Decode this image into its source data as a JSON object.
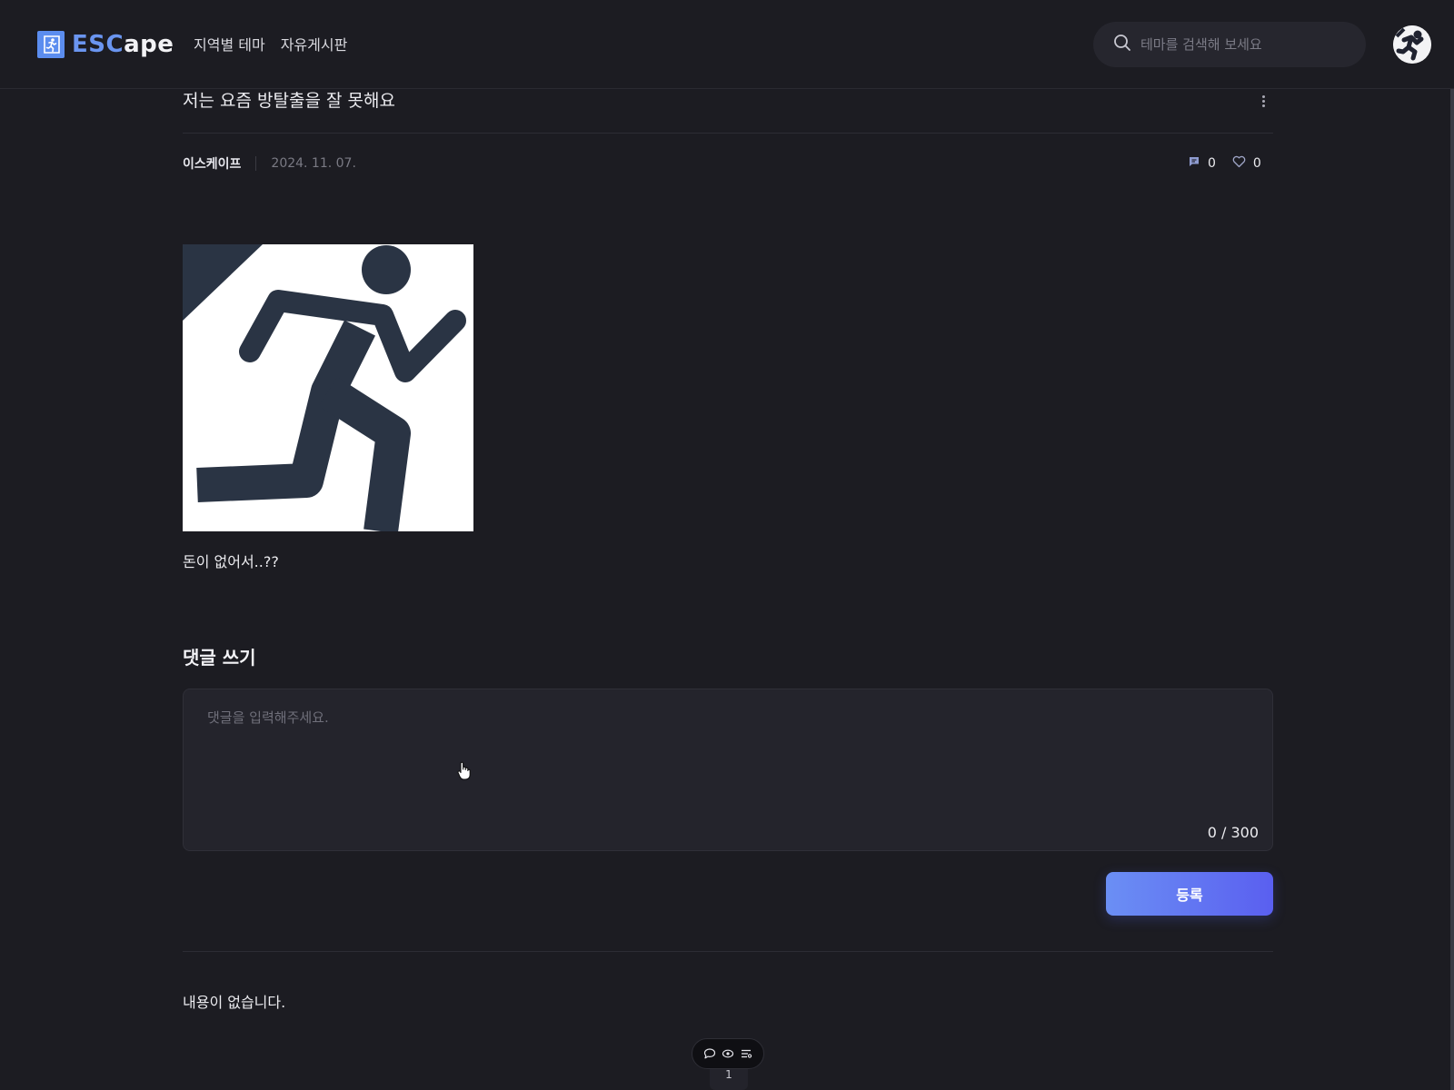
{
  "header": {
    "logo_text_highlight": "ESC",
    "logo_text_rest": "ape",
    "nav": [
      {
        "label": "지역별 테마"
      },
      {
        "label": "자유게시판"
      }
    ],
    "search_placeholder": "테마를 검색해 보세요"
  },
  "post": {
    "title": "저는 요즘 방탈출을 잘 못해요",
    "author": "이스케이프",
    "date": "2024. 11. 07.",
    "comment_count": "0",
    "like_count": "0",
    "body": "돈이 없어서..??"
  },
  "comments": {
    "heading": "댓글 쓰기",
    "placeholder": "댓글을 입력해주세요.",
    "char_count": "0 / 300",
    "submit_label": "등록",
    "empty_text": "내용이 없습니다."
  },
  "pagination": {
    "current_page": "1"
  },
  "colors": {
    "background": "#1c1c22",
    "accent": "#6a95f0",
    "button_gradient_start": "#6b8ff4",
    "button_gradient_end": "#5a5ff0"
  }
}
